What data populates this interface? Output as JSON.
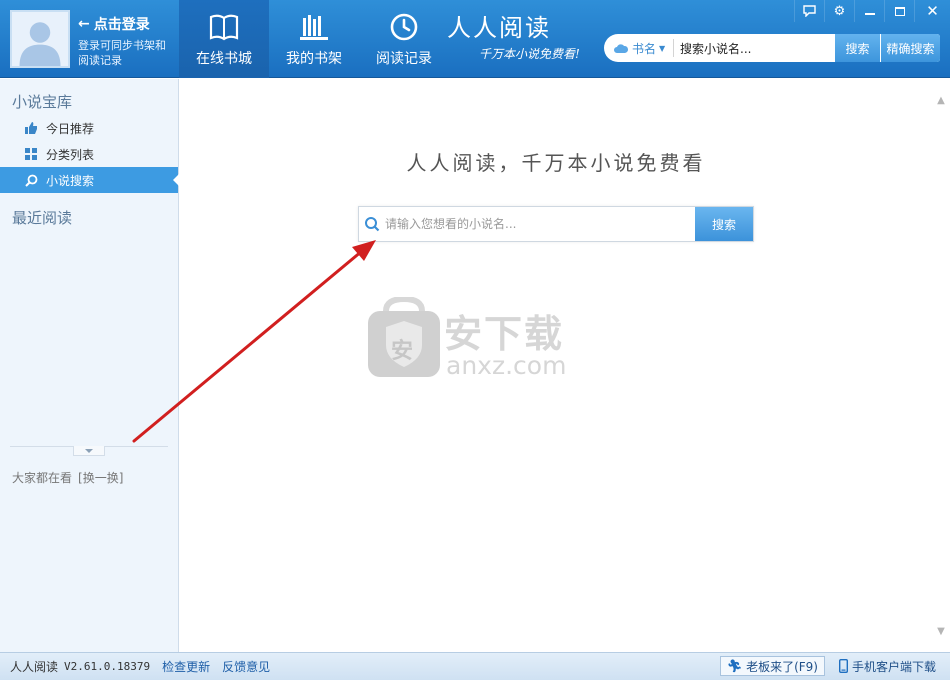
{
  "header": {
    "login_title": "点击登录",
    "login_sub": "登录可同步书架和阅读记录",
    "tabs": [
      {
        "label": "在线书城",
        "icon": "book-icon"
      },
      {
        "label": "我的书架",
        "icon": "bookshelf-icon"
      },
      {
        "label": "阅读记录",
        "icon": "clock-icon"
      }
    ],
    "brand_title": "人人阅读",
    "brand_slogan": "千万本小说免费看!",
    "search": {
      "type_label": "书名",
      "value": "搜索小说名...",
      "search_label": "搜索",
      "precise_label": "精确搜索"
    },
    "window_controls": [
      "feedback-icon",
      "settings-icon",
      "minimize-icon",
      "maximize-icon",
      "close-icon"
    ]
  },
  "sidebar": {
    "section1": "小说宝库",
    "items": [
      {
        "label": "今日推荐",
        "icon": "thumbs-up-icon"
      },
      {
        "label": "分类列表",
        "icon": "grid-icon"
      },
      {
        "label": "小说搜索",
        "icon": "search-icon"
      }
    ],
    "section2": "最近阅读",
    "popular_label": "大家都在看",
    "switch_label": "[换一换]"
  },
  "main": {
    "slogan": "人人阅读，千万本小说免费看",
    "search_placeholder": "请输入您想看的小说名...",
    "search_button": "搜索",
    "watermark_text": "安下载",
    "watermark_domain": "anxz.com",
    "watermark_logo_char": "安"
  },
  "status": {
    "app_name": "人人阅读",
    "version": "V2.61.0.18379",
    "check_update": "检查更新",
    "feedback": "反馈意见",
    "boss_key": "老板来了(F9)",
    "mobile_download": "手机客户端下载"
  },
  "colors": {
    "header_blue": "#1a6fc0",
    "accent_blue": "#3d9be2",
    "annotation_red": "#d11f1f"
  }
}
